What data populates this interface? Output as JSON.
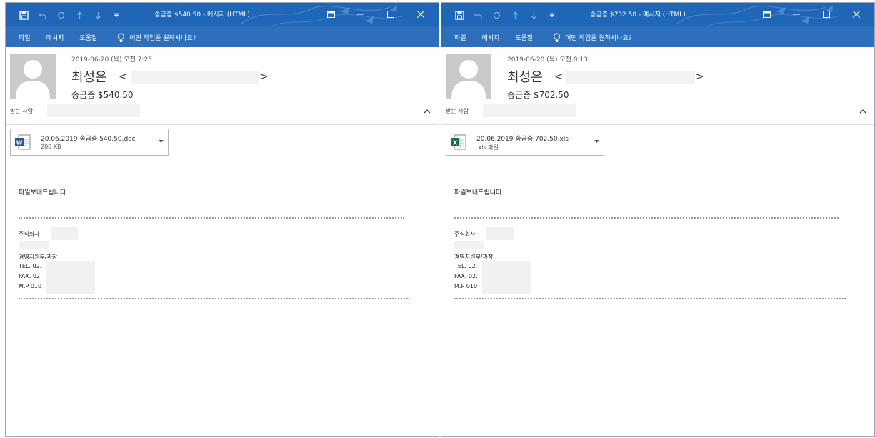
{
  "windows": [
    {
      "title": "송금증 $540.50 - 메시지 (HTML)",
      "ribbon": {
        "file": "파일",
        "message": "메시지",
        "help": "도움말",
        "tell_me": "어떤 작업을 원하시나요?"
      },
      "date": "2019-06-20 (목) 오전 7:25",
      "sender_name": "최성은",
      "addr_open": "<",
      "addr_close": ">",
      "subject": "송금증  $540.50",
      "to_label": "받는 사람",
      "attachment": {
        "name": "20.06.2019 송금증  540.50.doc",
        "detail": "200 KB",
        "type_icon": "word-doc-icon"
      },
      "body": {
        "greeting": "파일보내드립니다.",
        "company": "주식회사",
        "department": "경영지원부/과장",
        "tel": "TEL. 02.",
        "fax": "FAX. 02.",
        "mobile": "M.P 010"
      }
    },
    {
      "title": "송금증 $702.50 - 메시지 (HTML)",
      "ribbon": {
        "file": "파일",
        "message": "메시지",
        "help": "도움말",
        "tell_me": "어떤 작업을 원하시나요?"
      },
      "date": "2019-06-20 (목) 오전 8:13",
      "sender_name": "최성은",
      "addr_open": "<",
      "addr_close": ">",
      "subject": "송금증  $702.50",
      "to_label": "받는 사람",
      "attachment": {
        "name": "20.06.2019 송금증  702.50.xls",
        "detail": ".xls 파일",
        "type_icon": "excel-xls-icon"
      },
      "body": {
        "greeting": "파일보내드립니다.",
        "company": "주식회사",
        "department": "경영지원부/과장",
        "tel": "TEL. 02.",
        "fax": "FAX. 02.",
        "mobile": "M.P 010"
      }
    }
  ],
  "colors": {
    "title_bar": "#1f66b7",
    "ribbon": "#2b6fbd",
    "word_blue": "#2b5797",
    "excel_green": "#1e7145"
  }
}
